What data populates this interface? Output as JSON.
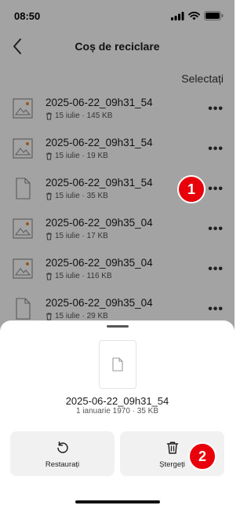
{
  "status_bar": {
    "time": "08:50"
  },
  "header": {
    "title": "Coș de reciclare",
    "select_label": "Selectați"
  },
  "files": [
    {
      "name": "2025-06-22_09h31_54",
      "meta": "15 iulie · 145 KB",
      "type": "image"
    },
    {
      "name": "2025-06-22_09h31_54",
      "meta": "15 iulie · 19 KB",
      "type": "image"
    },
    {
      "name": "2025-06-22_09h31_54",
      "meta": "15 iulie · 35 KB",
      "type": "document"
    },
    {
      "name": "2025-06-22_09h35_04",
      "meta": "15 iulie · 17 KB",
      "type": "image"
    },
    {
      "name": "2025-06-22_09h35_04",
      "meta": "15 iulie · 116 KB",
      "type": "image"
    },
    {
      "name": "2025-06-22_09h35_04",
      "meta": "15 iulie · 29 KB",
      "type": "document"
    }
  ],
  "more_glyph": "•••",
  "badges": {
    "first": "1",
    "second": "2"
  },
  "sheet": {
    "file_name": "2025-06-22_09h31_54",
    "file_meta": "1 ianuarie 1970 · 35 KB",
    "restore_label": "Restaurați",
    "delete_label": "Ștergeți"
  },
  "colors": {
    "badge": "#e8000b",
    "overlay": "rgba(0,0,0,0.36)",
    "icon_orange": "#f08a2c"
  },
  "icons": {
    "thumbnail_image": "image-file-icon",
    "thumbnail_doc": "document-icon",
    "meta": "trash-small-icon",
    "restore": "restore-icon",
    "delete": "trash-icon"
  }
}
